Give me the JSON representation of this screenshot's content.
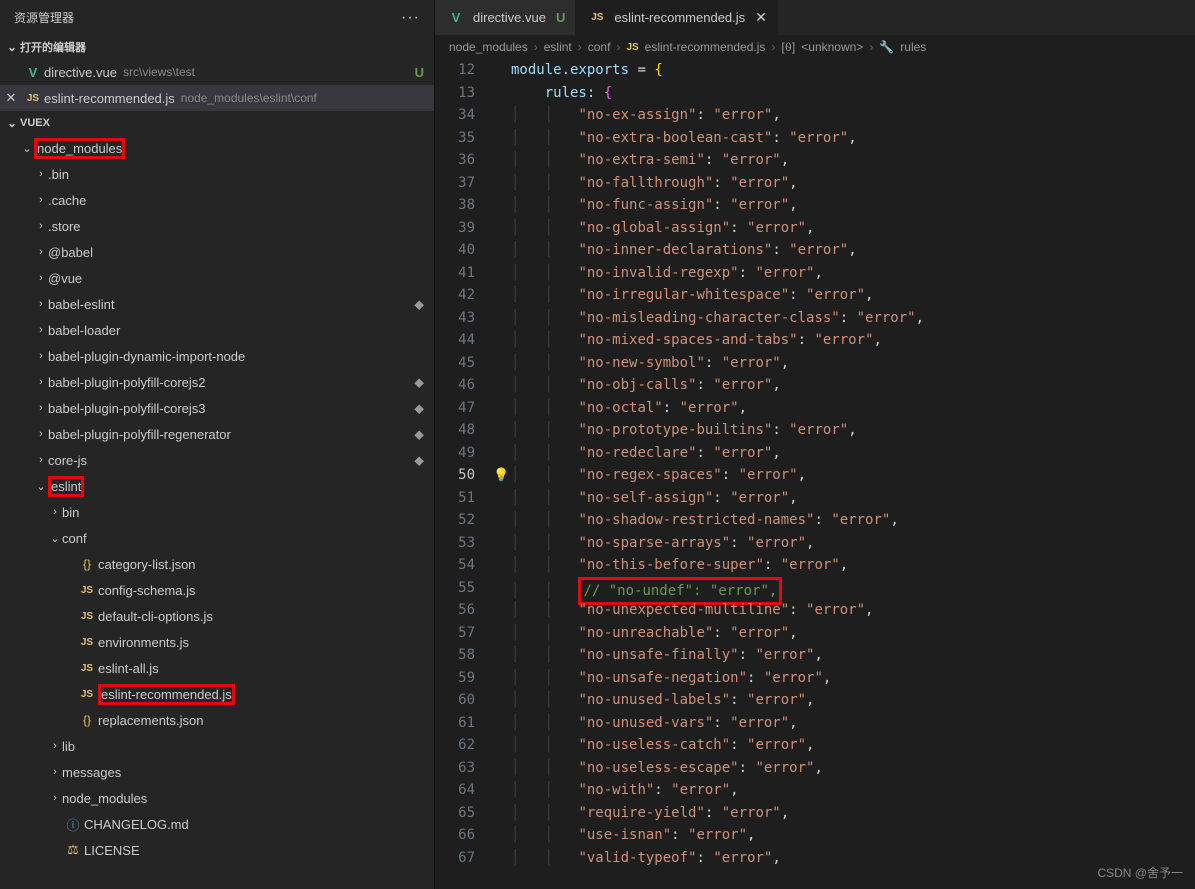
{
  "sidebar": {
    "title": "资源管理器",
    "dots": "···",
    "openEditors": {
      "header": "打开的编辑器",
      "items": [
        {
          "icon": "vue",
          "name": "directive.vue",
          "path": "src\\views\\test",
          "status": "U",
          "active": false
        },
        {
          "icon": "js",
          "name": "eslint-recommended.js",
          "path": "node_modules\\eslint\\conf",
          "status": "",
          "active": true
        }
      ]
    },
    "project": {
      "header": "VUEX",
      "tree": [
        {
          "depth": 1,
          "type": "folder",
          "open": true,
          "name": "node_modules",
          "redbox": true
        },
        {
          "depth": 2,
          "type": "folder",
          "open": false,
          "name": ".bin"
        },
        {
          "depth": 2,
          "type": "folder",
          "open": false,
          "name": ".cache"
        },
        {
          "depth": 2,
          "type": "folder",
          "open": false,
          "name": ".store"
        },
        {
          "depth": 2,
          "type": "folder",
          "open": false,
          "name": "@babel"
        },
        {
          "depth": 2,
          "type": "folder",
          "open": false,
          "name": "@vue"
        },
        {
          "depth": 2,
          "type": "folder",
          "open": false,
          "name": "babel-eslint",
          "mod": "dot"
        },
        {
          "depth": 2,
          "type": "folder",
          "open": false,
          "name": "babel-loader"
        },
        {
          "depth": 2,
          "type": "folder",
          "open": false,
          "name": "babel-plugin-dynamic-import-node"
        },
        {
          "depth": 2,
          "type": "folder",
          "open": false,
          "name": "babel-plugin-polyfill-corejs2",
          "mod": "dot"
        },
        {
          "depth": 2,
          "type": "folder",
          "open": false,
          "name": "babel-plugin-polyfill-corejs3",
          "mod": "dot"
        },
        {
          "depth": 2,
          "type": "folder",
          "open": false,
          "name": "babel-plugin-polyfill-regenerator",
          "mod": "dot"
        },
        {
          "depth": 2,
          "type": "folder",
          "open": false,
          "name": "core-js",
          "mod": "dot"
        },
        {
          "depth": 2,
          "type": "folder",
          "open": true,
          "name": "eslint",
          "redbox": true
        },
        {
          "depth": 3,
          "type": "folder",
          "open": false,
          "name": "bin"
        },
        {
          "depth": 3,
          "type": "folder",
          "open": true,
          "name": "conf"
        },
        {
          "depth": 4,
          "type": "file",
          "icon": "json",
          "name": "category-list.json"
        },
        {
          "depth": 4,
          "type": "file",
          "icon": "js",
          "name": "config-schema.js"
        },
        {
          "depth": 4,
          "type": "file",
          "icon": "js",
          "name": "default-cli-options.js"
        },
        {
          "depth": 4,
          "type": "file",
          "icon": "js",
          "name": "environments.js"
        },
        {
          "depth": 4,
          "type": "file",
          "icon": "js",
          "name": "eslint-all.js"
        },
        {
          "depth": 4,
          "type": "file",
          "icon": "js",
          "name": "eslint-recommended.js",
          "redbox": true
        },
        {
          "depth": 4,
          "type": "file",
          "icon": "json",
          "name": "replacements.json"
        },
        {
          "depth": 3,
          "type": "folder",
          "open": false,
          "name": "lib"
        },
        {
          "depth": 3,
          "type": "folder",
          "open": false,
          "name": "messages"
        },
        {
          "depth": 3,
          "type": "folder",
          "open": false,
          "name": "node_modules"
        },
        {
          "depth": 3,
          "type": "file",
          "icon": "md",
          "name": "CHANGELOG.md"
        },
        {
          "depth": 3,
          "type": "file",
          "icon": "lic",
          "name": "LICENSE"
        }
      ]
    }
  },
  "editor": {
    "tabs": [
      {
        "icon": "vue",
        "label": "directive.vue",
        "status": "U",
        "active": false
      },
      {
        "icon": "js",
        "label": "eslint-recommended.js",
        "status": "close",
        "active": true
      }
    ],
    "breadcrumb": {
      "parts": [
        "node_modules",
        "eslint",
        "conf"
      ],
      "file": {
        "icon": "js",
        "name": "eslint-recommended.js"
      },
      "syms": [
        {
          "icon": "unknown",
          "name": "<unknown>"
        },
        {
          "icon": "rules",
          "name": "rules"
        }
      ]
    },
    "gutter": {
      "head": [
        12,
        13
      ],
      "body_start": 34,
      "body_end": 67,
      "current": 50
    },
    "code": {
      "head1": {
        "obj": "module",
        "prop": "exports"
      },
      "head2": {
        "key": "rules"
      },
      "rules": [
        {
          "ln": 34,
          "key": "no-ex-assign",
          "val": "error"
        },
        {
          "ln": 35,
          "key": "no-extra-boolean-cast",
          "val": "error"
        },
        {
          "ln": 36,
          "key": "no-extra-semi",
          "val": "error"
        },
        {
          "ln": 37,
          "key": "no-fallthrough",
          "val": "error"
        },
        {
          "ln": 38,
          "key": "no-func-assign",
          "val": "error"
        },
        {
          "ln": 39,
          "key": "no-global-assign",
          "val": "error"
        },
        {
          "ln": 40,
          "key": "no-inner-declarations",
          "val": "error"
        },
        {
          "ln": 41,
          "key": "no-invalid-regexp",
          "val": "error"
        },
        {
          "ln": 42,
          "key": "no-irregular-whitespace",
          "val": "error"
        },
        {
          "ln": 43,
          "key": "no-misleading-character-class",
          "val": "error"
        },
        {
          "ln": 44,
          "key": "no-mixed-spaces-and-tabs",
          "val": "error"
        },
        {
          "ln": 45,
          "key": "no-new-symbol",
          "val": "error"
        },
        {
          "ln": 46,
          "key": "no-obj-calls",
          "val": "error"
        },
        {
          "ln": 47,
          "key": "no-octal",
          "val": "error"
        },
        {
          "ln": 48,
          "key": "no-prototype-builtins",
          "val": "error"
        },
        {
          "ln": 49,
          "key": "no-redeclare",
          "val": "error"
        },
        {
          "ln": 50,
          "key": "no-regex-spaces",
          "val": "error",
          "bulb": true
        },
        {
          "ln": 51,
          "key": "no-self-assign",
          "val": "error"
        },
        {
          "ln": 52,
          "key": "no-shadow-restricted-names",
          "val": "error"
        },
        {
          "ln": 53,
          "key": "no-sparse-arrays",
          "val": "error"
        },
        {
          "ln": 54,
          "key": "no-this-before-super",
          "val": "error"
        },
        {
          "ln": 55,
          "comment": "// \"no-undef\": \"error\",",
          "redbox": true
        },
        {
          "ln": 56,
          "key": "no-unexpected-multiline",
          "val": "error"
        },
        {
          "ln": 57,
          "key": "no-unreachable",
          "val": "error"
        },
        {
          "ln": 58,
          "key": "no-unsafe-finally",
          "val": "error"
        },
        {
          "ln": 59,
          "key": "no-unsafe-negation",
          "val": "error"
        },
        {
          "ln": 60,
          "key": "no-unused-labels",
          "val": "error"
        },
        {
          "ln": 61,
          "key": "no-unused-vars",
          "val": "error"
        },
        {
          "ln": 62,
          "key": "no-useless-catch",
          "val": "error"
        },
        {
          "ln": 63,
          "key": "no-useless-escape",
          "val": "error"
        },
        {
          "ln": 64,
          "key": "no-with",
          "val": "error"
        },
        {
          "ln": 65,
          "key": "require-yield",
          "val": "error"
        },
        {
          "ln": 66,
          "key": "use-isnan",
          "val": "error"
        },
        {
          "ln": 67,
          "key": "valid-typeof",
          "val": "error"
        }
      ]
    }
  },
  "watermark": "CSDN @舍予一"
}
